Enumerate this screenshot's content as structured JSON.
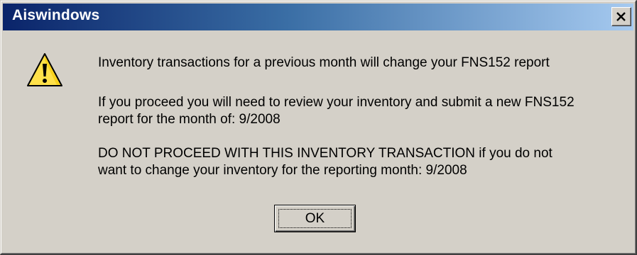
{
  "window": {
    "title": "Aiswindows",
    "close_icon": "close-x-icon"
  },
  "dialog": {
    "icon": "warning-triangle-icon",
    "message_line_1": "Inventory transactions for a previous month will change your FNS152 report",
    "message_line_2a": "If you proceed you will need to review your inventory and submit a new FNS152",
    "message_line_2b": "report for the month of: 9/2008",
    "message_line_3a": "DO NOT PROCEED WITH THIS INVENTORY TRANSACTION if you do not",
    "message_line_3b": "want to change your inventory for the reporting month: 9/2008",
    "ok_label": "OK"
  },
  "colors": {
    "titlebar_start": "#0a246a",
    "titlebar_end": "#a6caf0",
    "face": "#d4d0c8",
    "warning_fill": "#ffe14a"
  }
}
